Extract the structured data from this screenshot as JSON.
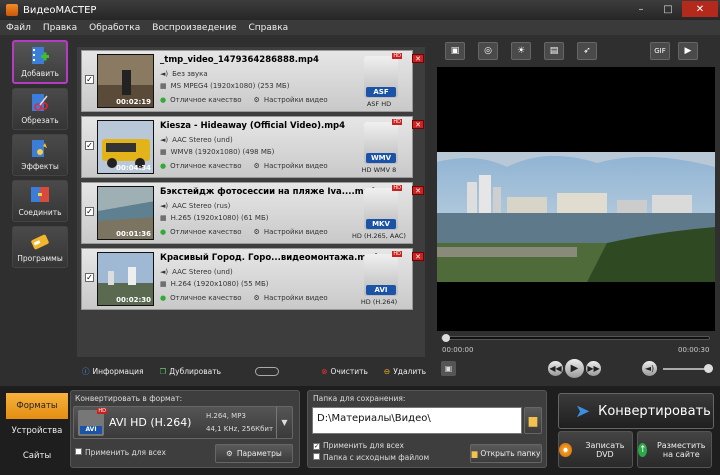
{
  "window": {
    "title": "ВидеоМАСТЕР"
  },
  "menu": [
    "Файл",
    "Правка",
    "Обработка",
    "Воспроизведение",
    "Справка"
  ],
  "sidebar": [
    {
      "label": "Добавить",
      "icon": "add-film-icon",
      "active": true
    },
    {
      "label": "Обрезать",
      "icon": "scissors-film-icon"
    },
    {
      "label": "Эффекты",
      "icon": "effects-film-icon"
    },
    {
      "label": "Соединить",
      "icon": "join-film-icon"
    },
    {
      "label": "Программы",
      "icon": "programs-icon"
    }
  ],
  "files": [
    {
      "name": "_tmp_video_1479364286888.mp4",
      "audio": "Без звука",
      "video": "MS MPEG4 (1920x1080) (253 МБ)",
      "duration": "00:02:19",
      "quality": "Отличное качество",
      "settings": "Настройки видео",
      "format_badge": "ASF",
      "format_name": "ASF HD",
      "thumb_color": "#7a6a55"
    },
    {
      "name": "Kiesza - Hideaway (Official Video).mp4",
      "audio": "AAC Stereo (und)",
      "video": "WMV8 (1920x1080) (498 МБ)",
      "duration": "00:04:34",
      "quality": "Отличное качество",
      "settings": "Настройки видео",
      "format_badge": "WMV",
      "format_name": "HD WMV 8",
      "thumb_color": "#c9a21a"
    },
    {
      "name": "Бэкстейдж фотосессии на пляже Iva....mp4",
      "audio": "AAC Stereo (rus)",
      "video": "H.265 (1920x1080) (61 МБ)",
      "duration": "00:01:36",
      "quality": "Отличное качество",
      "settings": "Настройки видео",
      "format_badge": "MKV",
      "format_name": "HD (H.265, AAC)",
      "thumb_color": "#6f7f7a"
    },
    {
      "name": "Красивый Город. Горо...видеомонтажа.mp4",
      "audio": "AAC Stereo (und)",
      "video": "H.264 (1920x1080) (55 МБ)",
      "duration": "00:02:30",
      "quality": "Отличное качество",
      "settings": "Настройки видео",
      "format_badge": "AVI",
      "format_name": "HD (H.264)",
      "thumb_color": "#6a88a8"
    }
  ],
  "list_tools": {
    "info": "Информация",
    "duplicate": "Дублировать",
    "clear": "Очистить",
    "delete": "Удалить"
  },
  "preview_tools": [
    "crop-icon",
    "rotate-icon",
    "brightness-icon",
    "subtitle-icon",
    "speed-icon"
  ],
  "preview_tools_right": [
    "GIF",
    "screenshot-icon"
  ],
  "player": {
    "time_start": "00:00:00",
    "time_end": "00:00:30",
    "progress": 0
  },
  "tabs": [
    "Форматы",
    "Устройства",
    "Сайты"
  ],
  "convert_format": {
    "label": "Конвертировать в формат:",
    "format": "AVI HD (H.264)",
    "codec": "H.264, MP3",
    "audio": "44,1 KHz, 256Кбит",
    "badge": "AVI",
    "apply_all": "Применить для всех",
    "params": "Параметры"
  },
  "save": {
    "label": "Папка для сохранения:",
    "path": "D:\\Материалы\\Видео\\",
    "apply_all": "Применить для всех",
    "source_folder": "Папка с исходным файлом",
    "open_folder": "Открыть папку"
  },
  "actions": {
    "convert": "Конвертировать",
    "burn_dvd": "Записать DVD",
    "upload": "Разместить на сайте"
  }
}
